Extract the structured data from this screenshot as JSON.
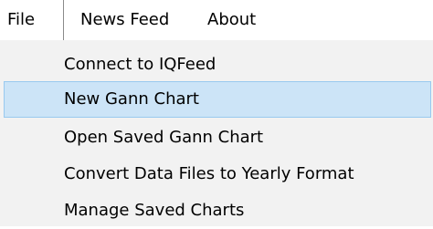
{
  "menubar": {
    "items": [
      {
        "label": "File",
        "open": true
      },
      {
        "label": "News Feed",
        "open": false
      },
      {
        "label": "About",
        "open": false
      }
    ]
  },
  "file_menu": {
    "items": [
      {
        "label": "Connect to IQFeed",
        "highlighted": false
      },
      {
        "label": "New Gann Chart",
        "highlighted": true
      },
      {
        "label": "Open Saved Gann Chart",
        "highlighted": false
      },
      {
        "label": "Convert Data Files to Yearly Format",
        "highlighted": false
      },
      {
        "label": "Manage Saved Charts",
        "highlighted": false
      }
    ]
  },
  "colors": {
    "highlight_background": "#cce4f7",
    "highlight_border": "#99c9ef",
    "menu_background": "#f2f2f2"
  }
}
